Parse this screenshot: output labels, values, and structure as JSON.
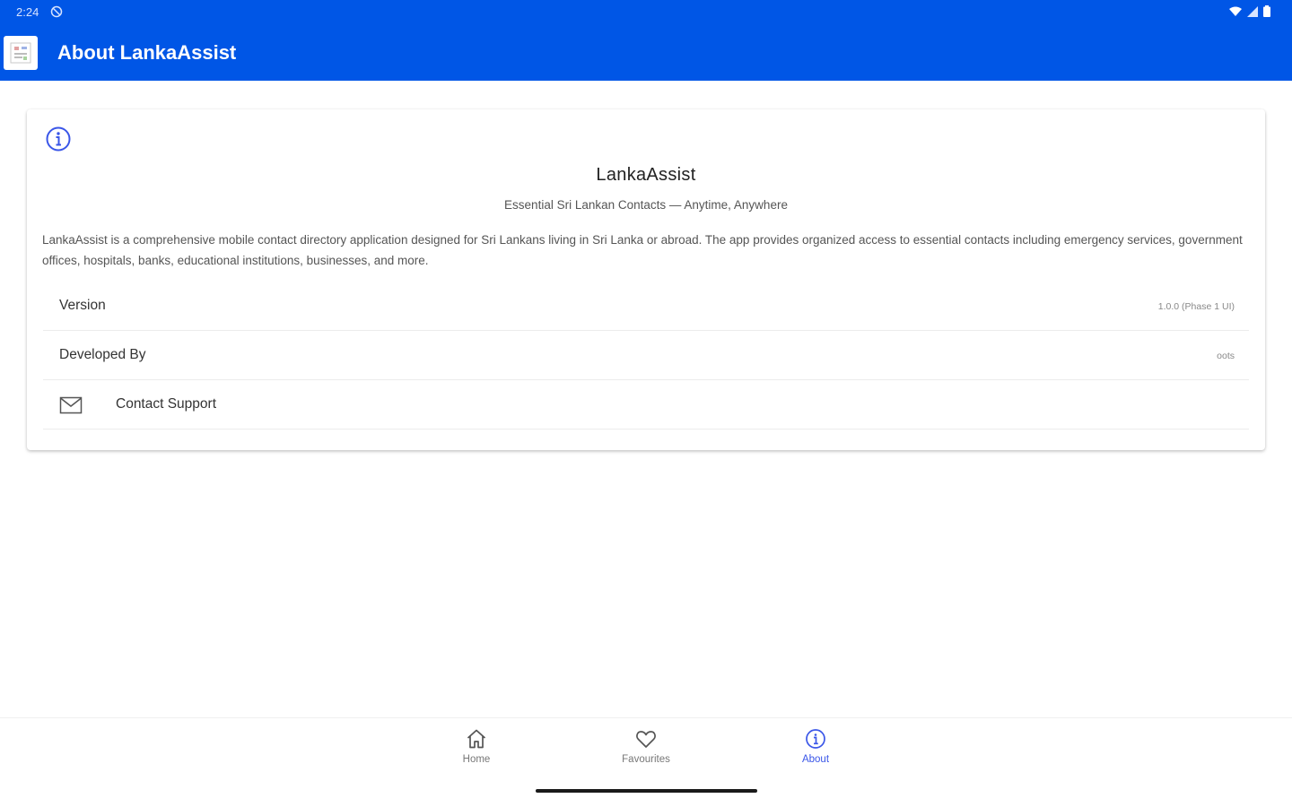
{
  "status": {
    "time": "2:24"
  },
  "header": {
    "title": "About LankaAssist",
    "logo_icon": "app-logo-icon"
  },
  "card": {
    "title": "LankaAssist",
    "tagline": "Essential Sri Lankan Contacts — Anytime, Anywhere",
    "description": "LankaAssist is a comprehensive mobile contact directory application designed for Sri Lankans living in Sri Lanka or abroad. The app provides organized access to essential contacts including emergency services, government offices, hospitals, banks, educational institutions, businesses, and more.",
    "rows": {
      "version": {
        "label": "Version",
        "value": "1.0.0 (Phase 1 UI)"
      },
      "developer": {
        "label": "Developed By",
        "value": "oots"
      },
      "support": {
        "label": "Contact Support",
        "icon": "mail-icon"
      }
    }
  },
  "nav": {
    "items": [
      {
        "label": "Home",
        "icon": "home-icon"
      },
      {
        "label": "Favourites",
        "icon": "heart-icon"
      },
      {
        "label": "About",
        "icon": "info-icon",
        "active": true
      }
    ]
  },
  "colors": {
    "primary": "#0056e6",
    "accent": "#3a56e8"
  }
}
